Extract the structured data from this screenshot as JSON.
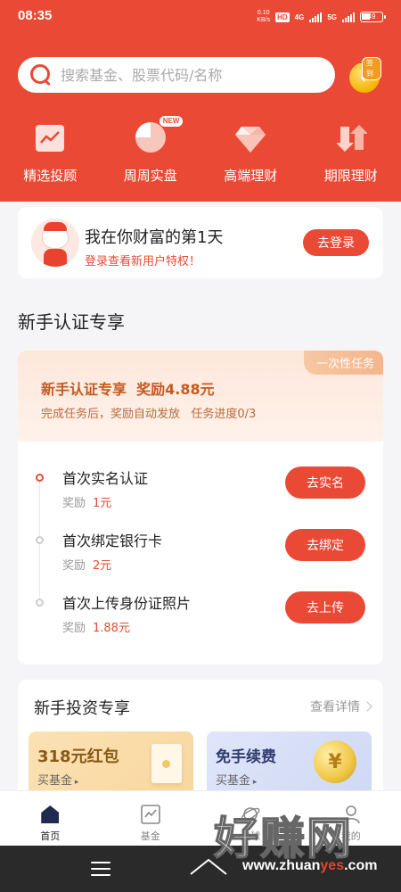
{
  "status_bar": {
    "time": "08:35",
    "net_speed_value": "0.10",
    "net_speed_unit": "KB/s",
    "hd": "HD",
    "network_1": "4G",
    "network_2": "5G",
    "battery": "49"
  },
  "header": {
    "search_placeholder": "搜索基金、股票代码/名称",
    "signin_label": "签到"
  },
  "quick_nav": [
    {
      "label": "精选投顾",
      "icon": "trend-chart-icon"
    },
    {
      "label": "周周实盘",
      "icon": "pie-chart-icon",
      "badge": "NEW"
    },
    {
      "label": "高端理财",
      "icon": "diamond-icon"
    },
    {
      "label": "期限理财",
      "icon": "swap-arrows-icon"
    }
  ],
  "login_card": {
    "title": "我在你财富的第1天",
    "subtitle": "登录查看新用户特权！",
    "button": "去登录"
  },
  "newbie_section": {
    "title": "新手认证专享",
    "tag": "一次性任务",
    "headline": "新手认证专享  奖励4.88元",
    "description": "完成任务后，奖励自动发放   任务进度0/3",
    "tasks": [
      {
        "name": "首次实名认证",
        "reward_label": "奖励",
        "reward": "1元",
        "button": "去实名"
      },
      {
        "name": "首次绑定银行卡",
        "reward_label": "奖励",
        "reward": "2元",
        "button": "去绑定"
      },
      {
        "name": "首次上传身份证照片",
        "reward_label": "奖励",
        "reward": "1.88元",
        "button": "去上传"
      }
    ]
  },
  "invest_section": {
    "title": "新手投资专享",
    "more": "查看详情",
    "promos": [
      {
        "title": "318元红包",
        "subtitle": "买基金"
      },
      {
        "title": "免手续费",
        "subtitle": "买基金"
      }
    ]
  },
  "tab_bar": [
    {
      "label": "首页",
      "active": true
    },
    {
      "label": "基金",
      "active": false
    },
    {
      "label": "星球",
      "active": false
    },
    {
      "label": "我的",
      "active": false
    }
  ],
  "watermark": {
    "text": "好赚网",
    "url_prefix": "www.zhuan",
    "url_highlight": "yes",
    "url_suffix": ".com"
  },
  "colors": {
    "brand_red": "#ea4a35",
    "background": "#f5f5f7",
    "task_headline": "#c55a1f"
  }
}
